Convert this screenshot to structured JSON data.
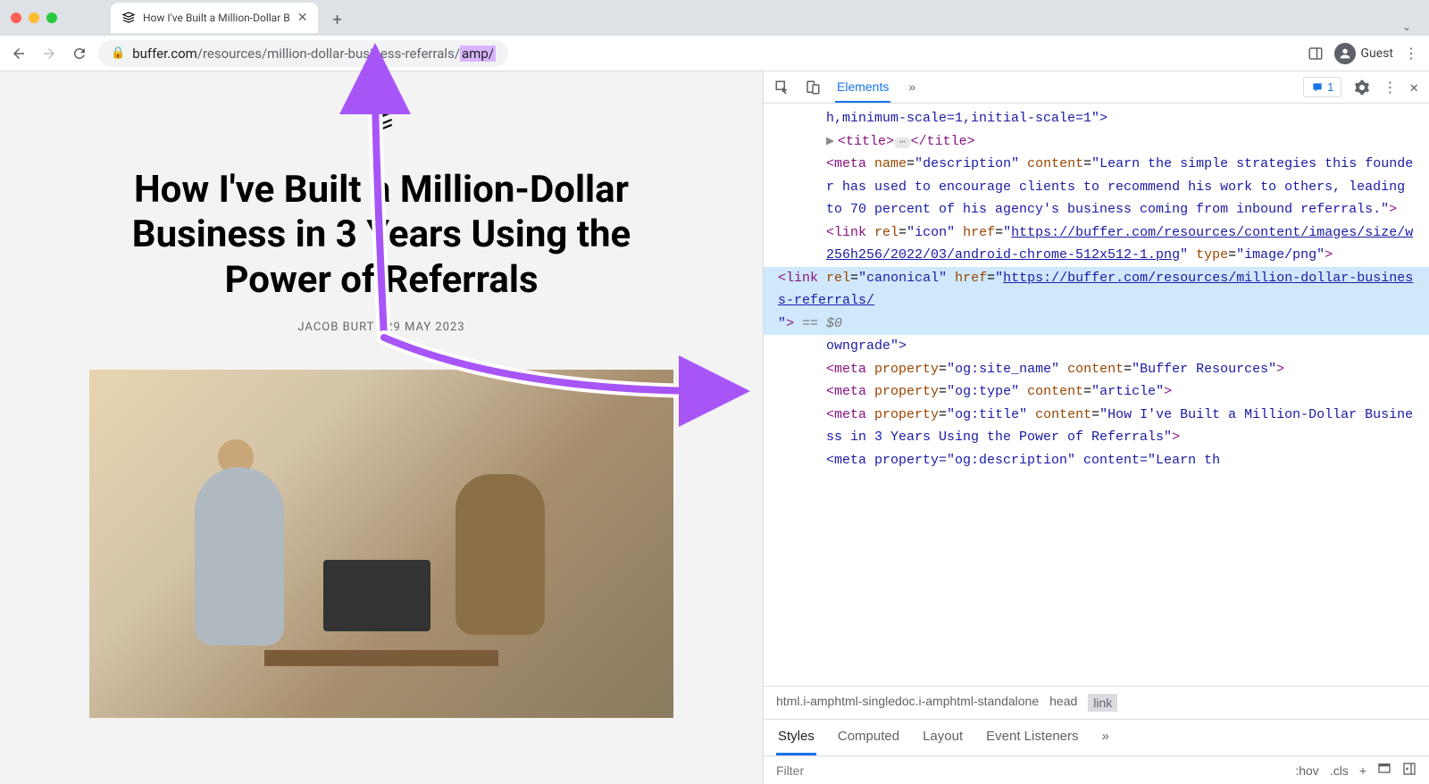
{
  "tab": {
    "title": "How I've Built a Million-Dollar B",
    "favicon": "≡"
  },
  "url": {
    "domain": "buffer.com",
    "path": "/resources/million-dollar-business-referrals/",
    "amp_segment": "amp/"
  },
  "toolbar": {
    "guest_label": "Guest"
  },
  "article": {
    "title": "How I've Built a Million-Dollar Business in 3 Years Using the Power of Referrals",
    "author": "JACOB BURT",
    "date": "29 MAY 2023"
  },
  "devtools": {
    "tabs": {
      "elements": "Elements"
    },
    "issues_count": "1",
    "elements": {
      "line1": "h,minimum-scale=1,initial-scale=1\">",
      "title_open": "<title>",
      "title_close": "</title>",
      "meta_desc_tag": "<meta",
      "meta_desc_name_attr": "name",
      "meta_desc_name_val": "\"description\"",
      "meta_desc_content_attr": "content",
      "meta_desc_content_val": "\"Learn the simple strategies this founder has used to encourage clients to recommend his work to others, leading to 70 percent of his agency's business coming from inbound referrals.\"",
      "link_icon_tag": "<link",
      "link_icon_rel_attr": "rel",
      "link_icon_rel_val": "\"icon\"",
      "link_icon_href_attr": "href",
      "link_icon_href_val": "https://buffer.com/resources/content/images/size/w256h256/2022/03/android-chrome-512x512-1.png",
      "link_icon_type_attr": "type",
      "link_icon_type_val": "\"image/png\"",
      "link_canon_tag": "<link",
      "link_canon_rel_attr": "rel",
      "link_canon_rel_val": "\"canonical\"",
      "link_canon_href_attr": "href",
      "link_canon_href_val": "https://buffer.com/resources/million-dollar-business-referrals/",
      "eq0": "== $0",
      "meta_referrer_trail": "owngrade\">",
      "og_site_tag": "<meta",
      "og_site_prop_attr": "property",
      "og_site_prop_val": "\"og:site_name\"",
      "og_site_content_attr": "content",
      "og_site_content_val": "\"Buffer Resources\"",
      "og_type_tag": "<meta",
      "og_type_prop_attr": "property",
      "og_type_prop_val": "\"og:type\"",
      "og_type_content_attr": "content",
      "og_type_content_val": "\"article\"",
      "og_title_tag": "<meta",
      "og_title_prop_attr": "property",
      "og_title_prop_val": "\"og:title\"",
      "og_title_content_attr": "content",
      "og_title_content_val": "\"How I've Built a Million-Dollar Business in 3 Years Using the Power of Referrals\"",
      "og_desc_trail": "<meta property=\"og:description\" content=\"Learn th"
    },
    "breadcrumb": {
      "html": "html.i-amphtml-singledoc.i-amphtml-standalone",
      "head": "head",
      "link": "link"
    },
    "styles_tabs": {
      "styles": "Styles",
      "computed": "Computed",
      "layout": "Layout",
      "listeners": "Event Listeners"
    },
    "filter": {
      "placeholder": "Filter",
      "hov": ":hov",
      "cls": ".cls"
    }
  }
}
